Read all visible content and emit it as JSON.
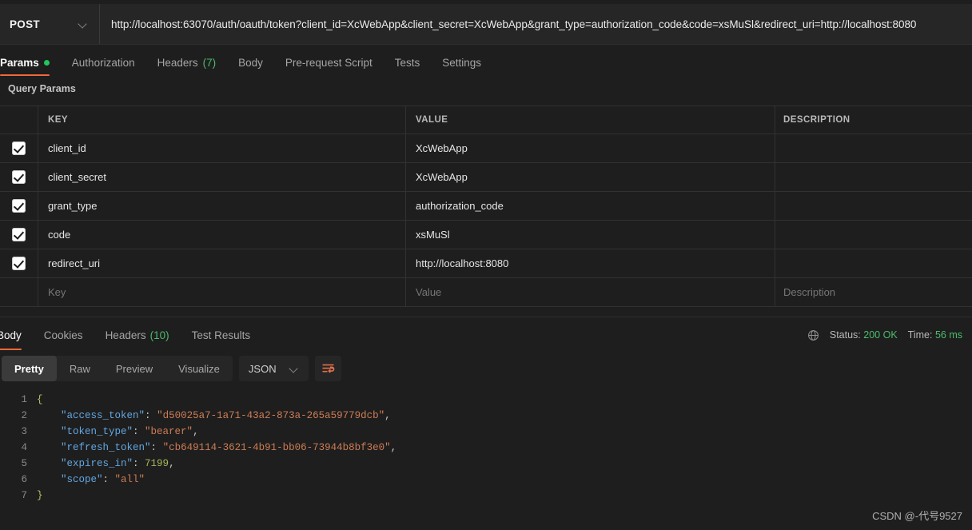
{
  "request": {
    "method": "POST",
    "url": "http://localhost:63070/auth/oauth/token?client_id=XcWebApp&client_secret=XcWebApp&grant_type=authorization_code&code=xsMuSl&redirect_uri=http://localhost:8080",
    "tabs": [
      {
        "label": "Params",
        "badge": "",
        "has_dot": true,
        "active": true
      },
      {
        "label": "Authorization",
        "badge": "",
        "has_dot": false,
        "active": false
      },
      {
        "label": "Headers",
        "badge": "(7)",
        "has_dot": false,
        "active": false
      },
      {
        "label": "Body",
        "badge": "",
        "has_dot": false,
        "active": false
      },
      {
        "label": "Pre-request Script",
        "badge": "",
        "has_dot": false,
        "active": false
      },
      {
        "label": "Tests",
        "badge": "",
        "has_dot": false,
        "active": false
      },
      {
        "label": "Settings",
        "badge": "",
        "has_dot": false,
        "active": false
      }
    ],
    "section_label": "Query Params",
    "table": {
      "headers": {
        "key": "KEY",
        "value": "VALUE",
        "description": "DESCRIPTION"
      },
      "rows": [
        {
          "checked": true,
          "key": "client_id",
          "value": "XcWebApp",
          "description": ""
        },
        {
          "checked": true,
          "key": "client_secret",
          "value": "XcWebApp",
          "description": ""
        },
        {
          "checked": true,
          "key": "grant_type",
          "value": "authorization_code",
          "description": ""
        },
        {
          "checked": true,
          "key": "code",
          "value": "xsMuSl",
          "description": ""
        },
        {
          "checked": true,
          "key": "redirect_uri",
          "value": "http://localhost:8080",
          "description": ""
        }
      ],
      "placeholder_row": {
        "key": "Key",
        "value": "Value",
        "description": "Description"
      }
    }
  },
  "response": {
    "tabs": [
      {
        "label": "Body",
        "badge": "",
        "active": true
      },
      {
        "label": "Cookies",
        "badge": "",
        "active": false
      },
      {
        "label": "Headers",
        "badge": "(10)",
        "active": false
      },
      {
        "label": "Test Results",
        "badge": "",
        "active": false
      }
    ],
    "status_label": "Status:",
    "status_value": "200 OK",
    "time_label": "Time:",
    "time_value": "56 ms",
    "globe_icon": "globe-icon",
    "view_modes": [
      {
        "label": "Pretty",
        "active": true
      },
      {
        "label": "Raw",
        "active": false
      },
      {
        "label": "Preview",
        "active": false
      },
      {
        "label": "Visualize",
        "active": false
      }
    ],
    "format": "JSON",
    "wrap_icon": "word-wrap-icon",
    "body_json": {
      "lines": [
        {
          "n": "1",
          "segments": [
            {
              "t": "brace",
              "v": "{"
            }
          ]
        },
        {
          "n": "2",
          "segments": [
            {
              "t": "pun",
              "v": "    "
            },
            {
              "t": "key",
              "v": "\"access_token\""
            },
            {
              "t": "pun",
              "v": ": "
            },
            {
              "t": "str",
              "v": "\"d50025a7-1a71-43a2-873a-265a59779dcb\""
            },
            {
              "t": "pun",
              "v": ","
            }
          ]
        },
        {
          "n": "3",
          "segments": [
            {
              "t": "pun",
              "v": "    "
            },
            {
              "t": "key",
              "v": "\"token_type\""
            },
            {
              "t": "pun",
              "v": ": "
            },
            {
              "t": "str",
              "v": "\"bearer\""
            },
            {
              "t": "pun",
              "v": ","
            }
          ]
        },
        {
          "n": "4",
          "segments": [
            {
              "t": "pun",
              "v": "    "
            },
            {
              "t": "key",
              "v": "\"refresh_token\""
            },
            {
              "t": "pun",
              "v": ": "
            },
            {
              "t": "str",
              "v": "\"cb649114-3621-4b91-bb06-73944b8bf3e0\""
            },
            {
              "t": "pun",
              "v": ","
            }
          ]
        },
        {
          "n": "5",
          "segments": [
            {
              "t": "pun",
              "v": "    "
            },
            {
              "t": "key",
              "v": "\"expires_in\""
            },
            {
              "t": "pun",
              "v": ": "
            },
            {
              "t": "num",
              "v": "7199"
            },
            {
              "t": "pun",
              "v": ","
            }
          ]
        },
        {
          "n": "6",
          "segments": [
            {
              "t": "pun",
              "v": "    "
            },
            {
              "t": "key",
              "v": "\"scope\""
            },
            {
              "t": "pun",
              "v": ": "
            },
            {
              "t": "str",
              "v": "\"all\""
            }
          ]
        },
        {
          "n": "7",
          "segments": [
            {
              "t": "brace",
              "v": "}"
            }
          ]
        }
      ]
    }
  },
  "watermark": "CSDN @-代号9527",
  "colors": {
    "accent_orange": "#f2683c",
    "status_green": "#4cbb6c",
    "dot_green": "#23c55e",
    "background": "#1e1e1e",
    "panel": "#262626"
  }
}
